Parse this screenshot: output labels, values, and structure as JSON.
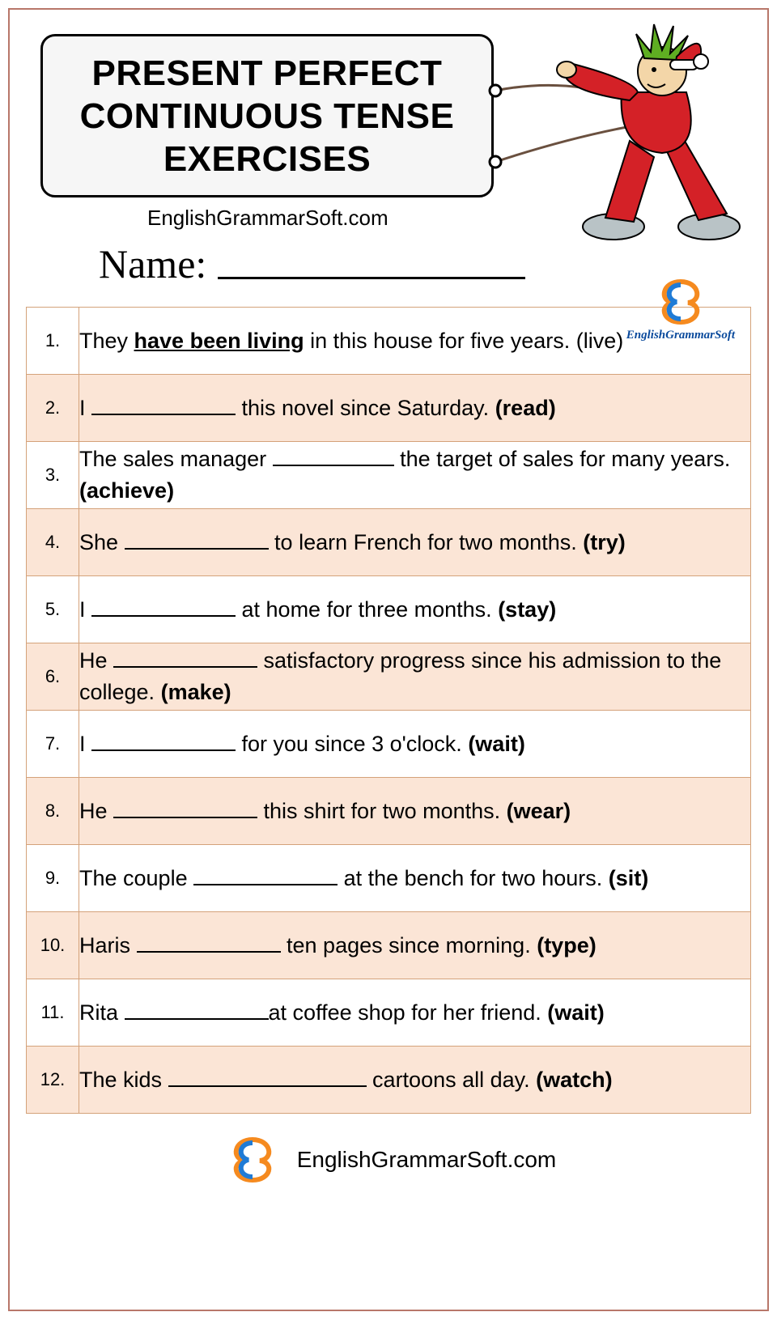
{
  "title": "PRESENT PERFECT CONTINUOUS TENSE EXERCISES",
  "site": "EnglishGrammarSoft.com",
  "name_label": "Name:",
  "logo_label": "EnglishGrammarSoft",
  "rows": [
    {
      "num": "1.",
      "pre": "They ",
      "example": "have been living",
      "post": " in this house for five years. ",
      "verb": "(live)",
      "verb_bold": false
    },
    {
      "num": "2.",
      "pre": "I ",
      "blank": "med",
      "post": " this novel since Saturday. ",
      "verb": "(read)",
      "verb_bold": true
    },
    {
      "num": "3.",
      "pre": "The sales manager ",
      "blank": "short",
      "post": " the target of sales for many years. ",
      "verb": "(achieve)",
      "verb_bold": true
    },
    {
      "num": "4.",
      "pre": "She ",
      "blank": "med",
      "post": " to learn French for two months. ",
      "verb": "(try)",
      "verb_bold": true
    },
    {
      "num": "5.",
      "pre": "I ",
      "blank": "med",
      "post": " at home for three months. ",
      "verb": "(stay)",
      "verb_bold": true
    },
    {
      "num": "6.",
      "pre": "He ",
      "blank": "med",
      "post": " satisfactory progress since his admission to the college. ",
      "verb": "(make)",
      "verb_bold": true
    },
    {
      "num": "7.",
      "pre": "I ",
      "blank": "med",
      "post": " for you since 3 o'clock. ",
      "verb": "(wait)",
      "verb_bold": true
    },
    {
      "num": "8.",
      "pre": "He ",
      "blank": "med",
      "post": " this shirt for two months. ",
      "verb": "(wear)",
      "verb_bold": true
    },
    {
      "num": "9.",
      "pre": "The couple ",
      "blank": "med",
      "post": " at the bench for two hours. ",
      "verb": "(sit)",
      "verb_bold": true
    },
    {
      "num": "10.",
      "pre": "Haris ",
      "blank": "med",
      "post": " ten pages since morning. ",
      "verb": "(type)",
      "verb_bold": true
    },
    {
      "num": "11.",
      "pre": "Rita ",
      "blank": "med",
      "post": "at coffee shop for her friend. ",
      "verb": "(wait)",
      "verb_bold": true
    },
    {
      "num": "12.",
      "pre": "The kids ",
      "blank": "long",
      "post": " cartoons all day. ",
      "verb": "(watch)",
      "verb_bold": true
    }
  ],
  "footer_site": "EnglishGrammarSoft.com"
}
